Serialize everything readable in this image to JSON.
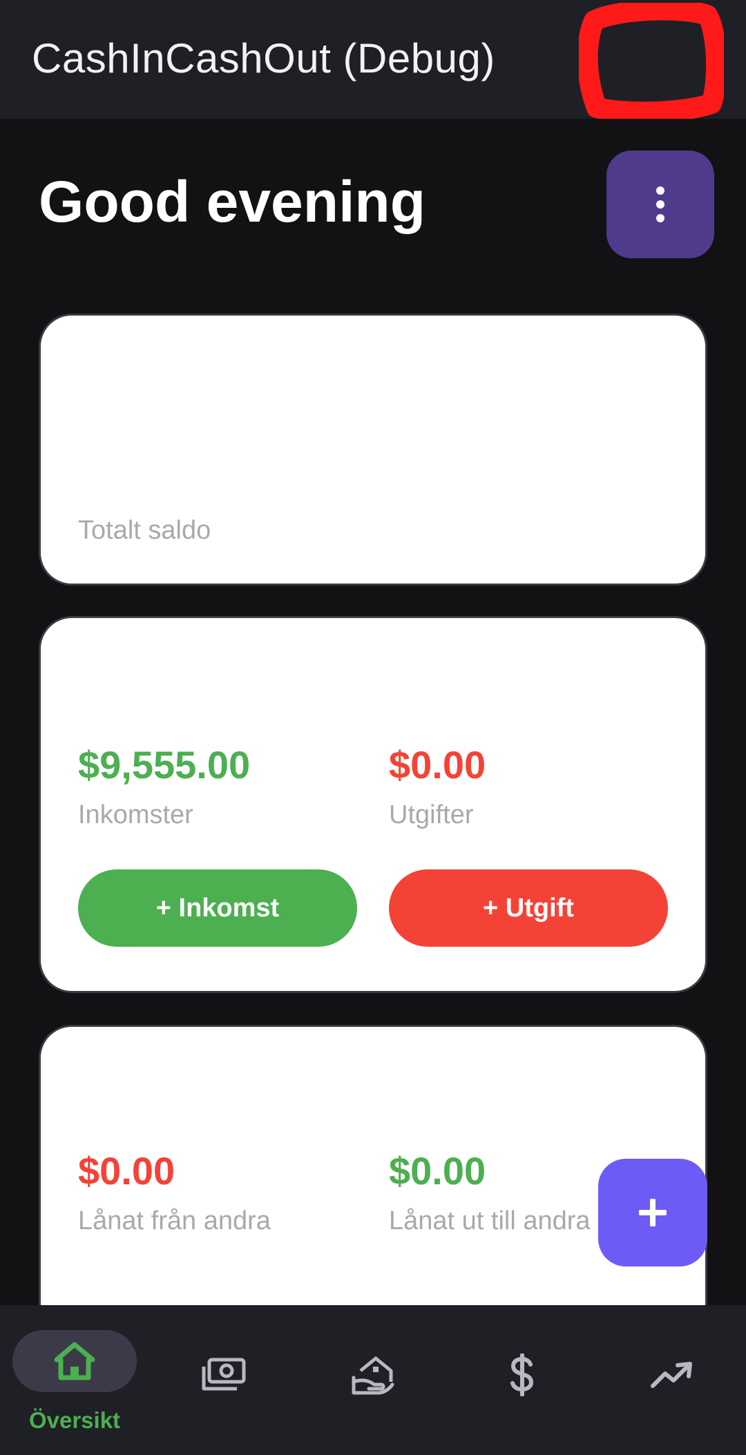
{
  "app_bar": {
    "title": "CashInCashOut (Debug)"
  },
  "header": {
    "greeting": "Good evening"
  },
  "balance_card": {
    "label": "Totalt saldo"
  },
  "flow_card": {
    "income_amount": "$9,555.00",
    "income_label": "Inkomster",
    "expense_amount": "$0.00",
    "expense_label": "Utgifter",
    "add_income_label": "+ Inkomst",
    "add_expense_label": "+ Utgift"
  },
  "loans_card": {
    "borrowed_amount": "$0.00",
    "borrowed_label": "Lånat från andra",
    "lent_amount": "$0.00",
    "lent_label": "Lånat ut till andra"
  },
  "fab": {
    "icon": "plus-icon"
  },
  "nav": {
    "items": [
      {
        "label": "Översikt",
        "icon": "home-icon",
        "selected": true
      },
      {
        "icon": "money-icon"
      },
      {
        "icon": "loan-icon"
      },
      {
        "icon": "dollar-icon"
      },
      {
        "icon": "trending-up-icon"
      }
    ]
  },
  "colors": {
    "background": "#121214",
    "bar": "#1f1f26",
    "income_green": "#4caf50",
    "expense_red": "#f44336",
    "menu_purple": "#4f3a8c",
    "fab_purple": "#6c5cf5",
    "redaction_red": "#ff1a1a"
  }
}
